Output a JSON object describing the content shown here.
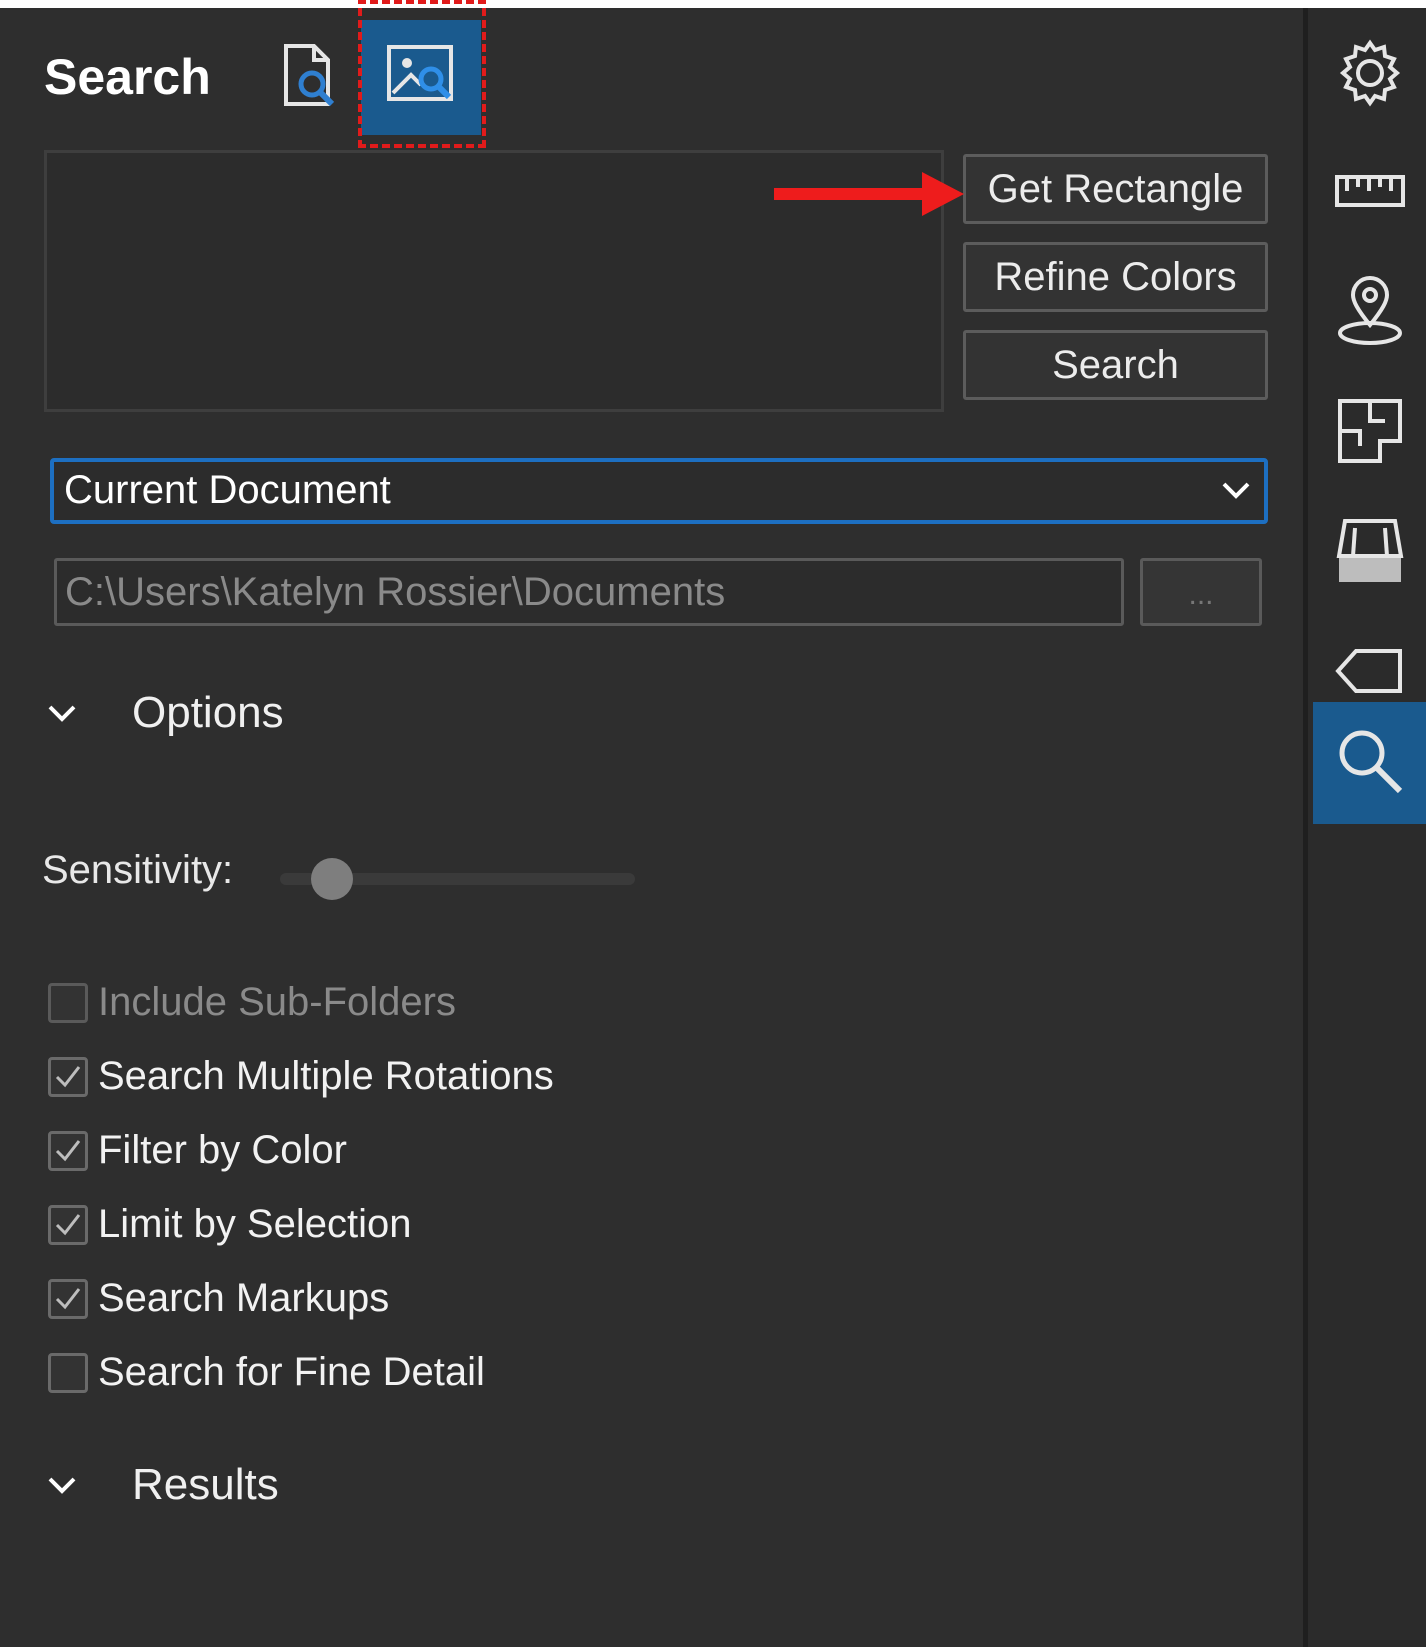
{
  "panel": {
    "title": "Search",
    "modes": [
      {
        "icon": "text-search-icon",
        "label": "Text Search"
      },
      {
        "icon": "image-search-icon",
        "label": "Visual Search",
        "active": true
      }
    ]
  },
  "actions": {
    "get_rectangle": "Get Rectangle",
    "refine_colors": "Refine Colors",
    "search": "Search"
  },
  "scope": {
    "selected": "Current Document",
    "folder_path": "C:\\Users\\Katelyn Rossier\\Documents",
    "browse_label": "..."
  },
  "options": {
    "heading": "Options",
    "sensitivity_label": "Sensitivity:",
    "sensitivity_value": 0.1,
    "checkboxes": [
      {
        "label": "Include Sub-Folders",
        "checked": false,
        "enabled": false
      },
      {
        "label": "Search Multiple Rotations",
        "checked": true,
        "enabled": true
      },
      {
        "label": "Filter by Color",
        "checked": true,
        "enabled": true
      },
      {
        "label": "Limit by Selection",
        "checked": true,
        "enabled": true
      },
      {
        "label": "Search Markups",
        "checked": true,
        "enabled": true
      },
      {
        "label": "Search for Fine Detail",
        "checked": false,
        "enabled": true
      }
    ]
  },
  "results": {
    "heading": "Results"
  },
  "rail": {
    "icons": [
      "gear-icon",
      "ruler-icon",
      "map-pin-icon",
      "floor-plan-icon",
      "stamp-icon",
      "tag-icon",
      "search-icon"
    ],
    "active": "search-icon"
  },
  "colors": {
    "accent": "#1a5a8e",
    "focus_border": "#1d6fc1",
    "annotation_red": "#e11b1b",
    "background": "#2e2e2e"
  }
}
